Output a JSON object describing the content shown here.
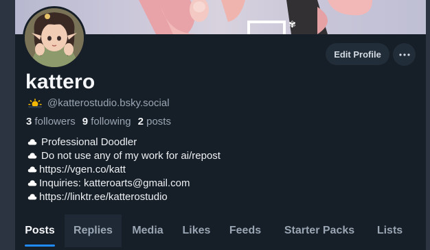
{
  "profile": {
    "display_name": "kattero",
    "handle": "@katterostudio.bsky.social",
    "handle_emoji": "🌥",
    "edit_label": "Edit Profile"
  },
  "stats": {
    "followers_count": "3",
    "followers_label": "followers",
    "following_count": "9",
    "following_label": "following",
    "posts_count": "2",
    "posts_label": "posts"
  },
  "bio": [
    {
      "icon": "cloud-icon",
      "text": "Professional Doodler"
    },
    {
      "icon": "cloud-icon",
      "text": "Do not use any of my work for ai/repost"
    },
    {
      "icon": "cloud-icon",
      "text": "https://vgen.co/katt"
    },
    {
      "icon": "cloud-icon",
      "text": "Inquiries: katteroarts@gmail.com"
    },
    {
      "icon": "cloud-icon",
      "text": "https://linktr.ee/katterostudio"
    }
  ],
  "tabs": [
    {
      "label": "Posts",
      "active": true
    },
    {
      "label": "Replies",
      "active": false
    },
    {
      "label": "Media",
      "active": false
    },
    {
      "label": "Likes",
      "active": false
    },
    {
      "label": "Feeds",
      "active": false
    },
    {
      "label": "Starter Packs",
      "active": false
    },
    {
      "label": "Lists",
      "active": false
    }
  ],
  "colors": {
    "background": "#161e27",
    "accent": "#208bfe",
    "muted_text": "#9aa6b4",
    "button_bg": "#222d3a"
  }
}
